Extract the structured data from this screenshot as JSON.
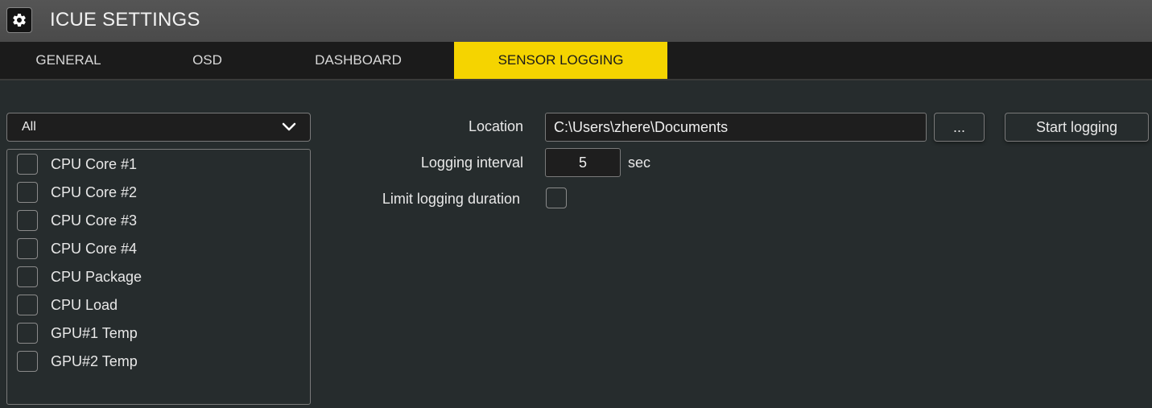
{
  "window": {
    "title": "ICUE SETTINGS",
    "icon": "gear-icon"
  },
  "tabs": [
    {
      "label": "GENERAL",
      "active": false
    },
    {
      "label": "OSD",
      "active": false
    },
    {
      "label": "DASHBOARD",
      "active": false
    },
    {
      "label": "SENSOR LOGGING",
      "active": true
    }
  ],
  "filter": {
    "selected": "All"
  },
  "sensors": [
    {
      "label": "CPU Core #1",
      "checked": false
    },
    {
      "label": "CPU Core #2",
      "checked": false
    },
    {
      "label": "CPU Core #3",
      "checked": false
    },
    {
      "label": "CPU Core #4",
      "checked": false
    },
    {
      "label": "CPU Package",
      "checked": false
    },
    {
      "label": "CPU Load",
      "checked": false
    },
    {
      "label": "GPU#1 Temp",
      "checked": false
    },
    {
      "label": "GPU#2 Temp",
      "checked": false
    }
  ],
  "settings": {
    "location_label": "Location",
    "location_value": "C:\\Users\\zhere\\Documents",
    "browse_label": "...",
    "start_label": "Start logging",
    "interval_label": "Logging interval",
    "interval_value": "5",
    "interval_unit": "sec",
    "limit_label": "Limit logging duration",
    "limit_checked": false
  },
  "colors": {
    "accent": "#f5d400",
    "background": "#262c2d",
    "titlebar": "#4d4d4d",
    "tabbar": "#1b1b1b"
  }
}
